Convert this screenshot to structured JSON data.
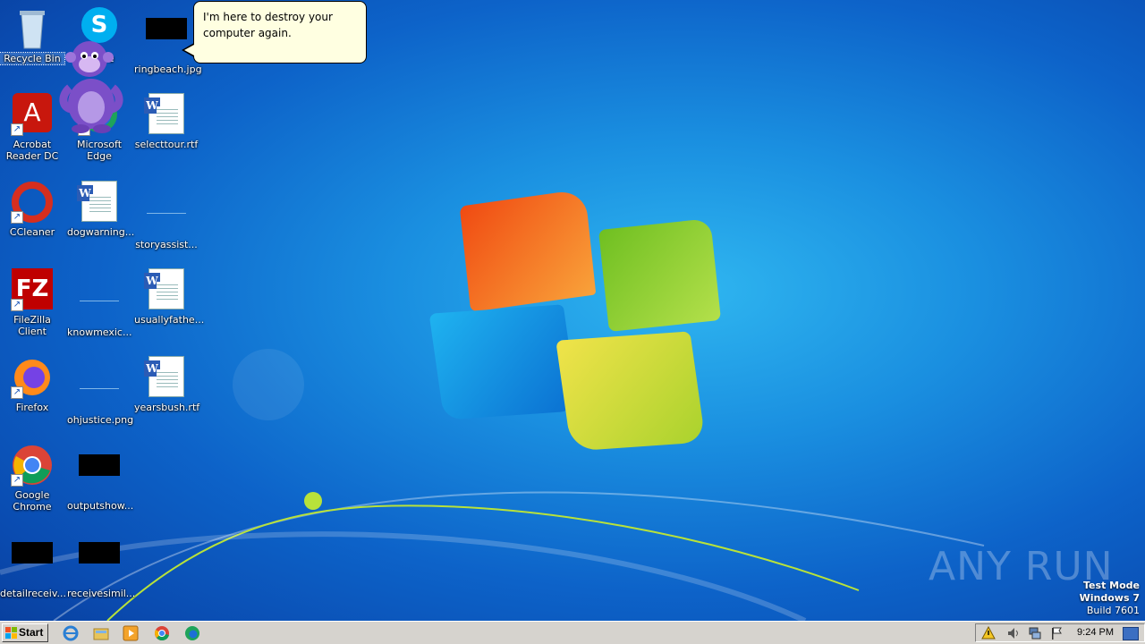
{
  "desktop": {
    "icons": [
      {
        "label": "Recycle Bin"
      },
      {
        "label": "Skype"
      },
      {
        "label": "ringbeach.jpg"
      },
      {
        "label": "Acrobat Reader DC"
      },
      {
        "label": "Microsoft Edge"
      },
      {
        "label": "selecttour.rtf"
      },
      {
        "label": "CCleaner"
      },
      {
        "label": "dogwarning..."
      },
      {
        "label": "storyassist..."
      },
      {
        "label": "FileZilla Client"
      },
      {
        "label": "knowmexic..."
      },
      {
        "label": "usuallyfathe..."
      },
      {
        "label": "Firefox"
      },
      {
        "label": "ohjustice.png"
      },
      {
        "label": "yearsbush.rtf"
      },
      {
        "label": "Google Chrome"
      },
      {
        "label": "outputshow..."
      },
      {
        "label": "detailreceiv..."
      },
      {
        "label": "receivesimil..."
      }
    ],
    "balloon_text": "I'm here to destroy your computer again."
  },
  "watermark": {
    "brand": "ANY RUN",
    "test_mode_line1": "Test Mode",
    "test_mode_line2": "Windows 7",
    "test_mode_line3": "Build 7601"
  },
  "taskbar": {
    "start_label": "Start",
    "quick_launch": [
      "internet-explorer-icon",
      "explorer-folder-icon",
      "media-player-icon",
      "chrome-icon",
      "edge-icon"
    ],
    "tray_icons": [
      "action-center-warning-icon",
      "volume-icon",
      "network-icon",
      "flag-icon"
    ],
    "clock": "9:24 PM"
  },
  "colors": {
    "desktop_blue": "#0d63c9",
    "balloon_bg": "#ffffe1",
    "taskbar_gray": "#d6d3ce"
  }
}
